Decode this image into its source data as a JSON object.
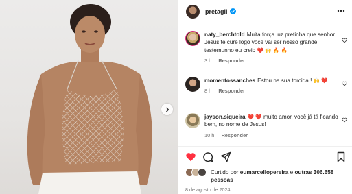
{
  "post": {
    "author": "pretagil",
    "verified": true
  },
  "comments": [
    {
      "user": "naty_berchtold",
      "text": "Muita força luz pretinha que senhor Jesus te cure logo você vai ser nosso grande testemunho eu creio",
      "emoji": "❤️ 🙌 🔥 🔥",
      "time": "3 h",
      "reply": "Responder"
    },
    {
      "user": "momentossanches",
      "text": "Estou na sua torcida !",
      "emoji": "🙌 ❤️",
      "time": "8 h",
      "reply": "Responder"
    },
    {
      "user": "jayson.siqueira",
      "emoji_lead": "❤️ ❤️",
      "text": "muito amor. você já tá ficando bem, no nome de Jesus!",
      "time": "10 h",
      "reply": "Responder"
    }
  ],
  "likes": {
    "prefix": "Curtido por",
    "user": "eumarcellopereira",
    "middle": "e",
    "others": "outras 306.658 pessoas"
  },
  "date": "8 de agosto de 2024",
  "icons": [
    "chevron-right-icon",
    "verified-badge-icon",
    "more-icon",
    "heart-icon",
    "comment-icon",
    "share-icon",
    "bookmark-icon"
  ],
  "colors": {
    "like_red": "#ff3040",
    "verified_blue": "#0095f6",
    "meta_gray": "#737373"
  }
}
